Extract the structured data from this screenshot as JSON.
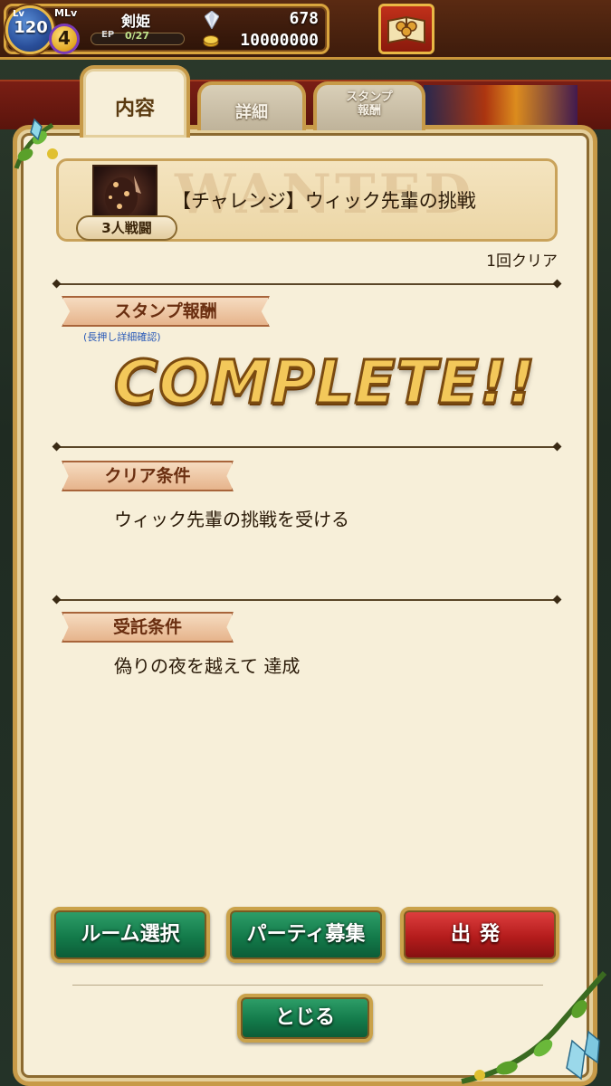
{
  "status": {
    "lv_label": "Lv",
    "level": "120",
    "mlv_label": "MLv",
    "master_level": "4",
    "player_name": "剣姫",
    "ep_label": "EP",
    "ep_value": "0/27",
    "gems": "678",
    "coins": "10000000"
  },
  "tabs": [
    {
      "label": "内容",
      "active": true
    },
    {
      "label": "詳細",
      "active": false
    },
    {
      "label": "スタンプ\n報酬",
      "active": false
    }
  ],
  "quest": {
    "watermark": "WANTED",
    "battle_badge": "3人戦闘",
    "title": "【チャレンジ】ウィック先輩の挑戦",
    "clear_count": "1回クリア"
  },
  "stamp_section": {
    "heading": "スタンプ報酬",
    "hint": "(長押し詳細確認)",
    "complete": "COMPLETE!!"
  },
  "clear_section": {
    "heading": "クリア条件",
    "text": "ウィック先輩の挑戦を受ける"
  },
  "accept_section": {
    "heading": "受託条件",
    "text": "偽りの夜を越えて 達成"
  },
  "buttons": {
    "room": "ルーム選択",
    "party": "パーティ募集",
    "depart": "出発",
    "close": "とじる"
  },
  "colors": {
    "panel": "#f7efd9",
    "frame": "#c79a48",
    "green_button": "#137a4a",
    "red_button": "#b41c1c"
  },
  "icons": [
    "gem-icon",
    "coin-icon",
    "book-icon",
    "quest-monster-icon"
  ]
}
